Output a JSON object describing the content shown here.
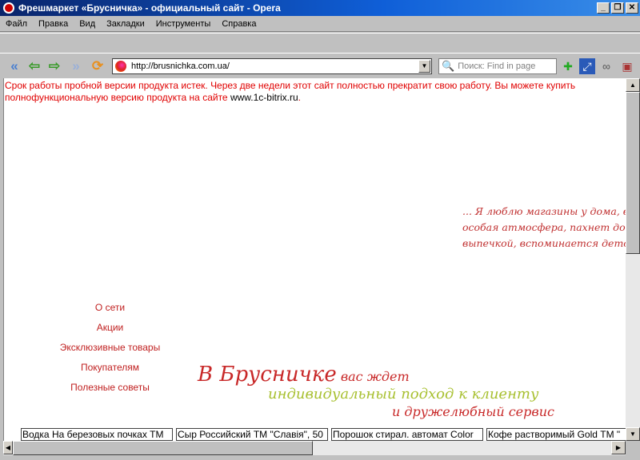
{
  "window": {
    "title": "Фрешмаркет «Брусничка» - официальный сайт - Opera",
    "minimize": "_",
    "restore": "❐",
    "close": "✕"
  },
  "menu": [
    "Файл",
    "Правка",
    "Вид",
    "Закладки",
    "Инструменты",
    "Справка"
  ],
  "nav": {
    "url": "http://brusnichka.com.ua/",
    "search_placeholder": "Поиск: Find in page"
  },
  "page": {
    "notice": "Срок работы пробной версии продукта истек. Через две недели этот сайт полностью прекратит свою работу. Вы можете купить полнофункциональную версию продукта на сайте ",
    "notice_link": "www.1c-bitrix.ru",
    "notice_end": ".",
    "quote": [
      "... Я люблю магазины у дома, в",
      "особая атмосфера, пахнет до",
      "выпечкой, вспоминается детс"
    ],
    "menu": [
      "О сети",
      "Акции",
      "Эксклюзивные товары",
      "Покупателям",
      "Полезные советы"
    ],
    "slogan": {
      "big": "В Брусничке",
      "small": " вас ждет",
      "line2": "индивидуальный подход к клиенту",
      "line3": "и дружелюбный сервис"
    },
    "ticker": [
      "Водка На березовых почках ТМ",
      "Сыр Российский ТМ \"Славія\", 50",
      "Порошок стирал. автомат Color",
      "Кофе растворимый Gold ТМ \""
    ]
  }
}
